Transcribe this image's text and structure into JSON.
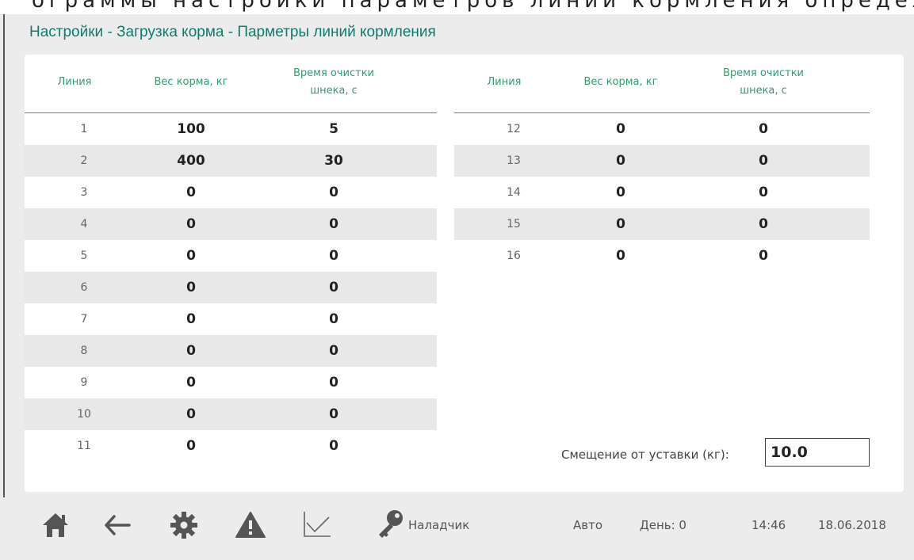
{
  "header": {
    "title": "Настройки - Загрузка корма - Парметры линий кормления"
  },
  "columns": {
    "line": "Линия",
    "weight": "Вес корма, кг",
    "clean_time": "Время очистки шнека, с"
  },
  "left_rows": [
    {
      "line": "1",
      "weight": "100",
      "clean": "5"
    },
    {
      "line": "2",
      "weight": "400",
      "clean": "30"
    },
    {
      "line": "3",
      "weight": "0",
      "clean": "0"
    },
    {
      "line": "4",
      "weight": "0",
      "clean": "0"
    },
    {
      "line": "5",
      "weight": "0",
      "clean": "0"
    },
    {
      "line": "6",
      "weight": "0",
      "clean": "0"
    },
    {
      "line": "7",
      "weight": "0",
      "clean": "0"
    },
    {
      "line": "8",
      "weight": "0",
      "clean": "0"
    },
    {
      "line": "9",
      "weight": "0",
      "clean": "0"
    },
    {
      "line": "10",
      "weight": "0",
      "clean": "0"
    },
    {
      "line": "11",
      "weight": "0",
      "clean": "0"
    }
  ],
  "right_rows": [
    {
      "line": "12",
      "weight": "0",
      "clean": "0"
    },
    {
      "line": "13",
      "weight": "0",
      "clean": "0"
    },
    {
      "line": "14",
      "weight": "0",
      "clean": "0"
    },
    {
      "line": "15",
      "weight": "0",
      "clean": "0"
    },
    {
      "line": "16",
      "weight": "0",
      "clean": "0"
    }
  ],
  "offset": {
    "label": "Смещение от уставки (кг):",
    "value": "10.0"
  },
  "footer": {
    "icons": [
      "home-icon",
      "back-arrow-icon",
      "gear-icon",
      "warning-icon",
      "chart-icon",
      "key-icon"
    ],
    "user": "Наладчик",
    "mode": "Авто",
    "day": "День: 0",
    "time": "14:46",
    "date": "18.06.2018"
  },
  "colors": {
    "title": "#0f7b6b",
    "header_text": "#2e9e6e",
    "row_shade": "#e8e8e8",
    "background": "#ececec",
    "icon": "#555555"
  }
}
